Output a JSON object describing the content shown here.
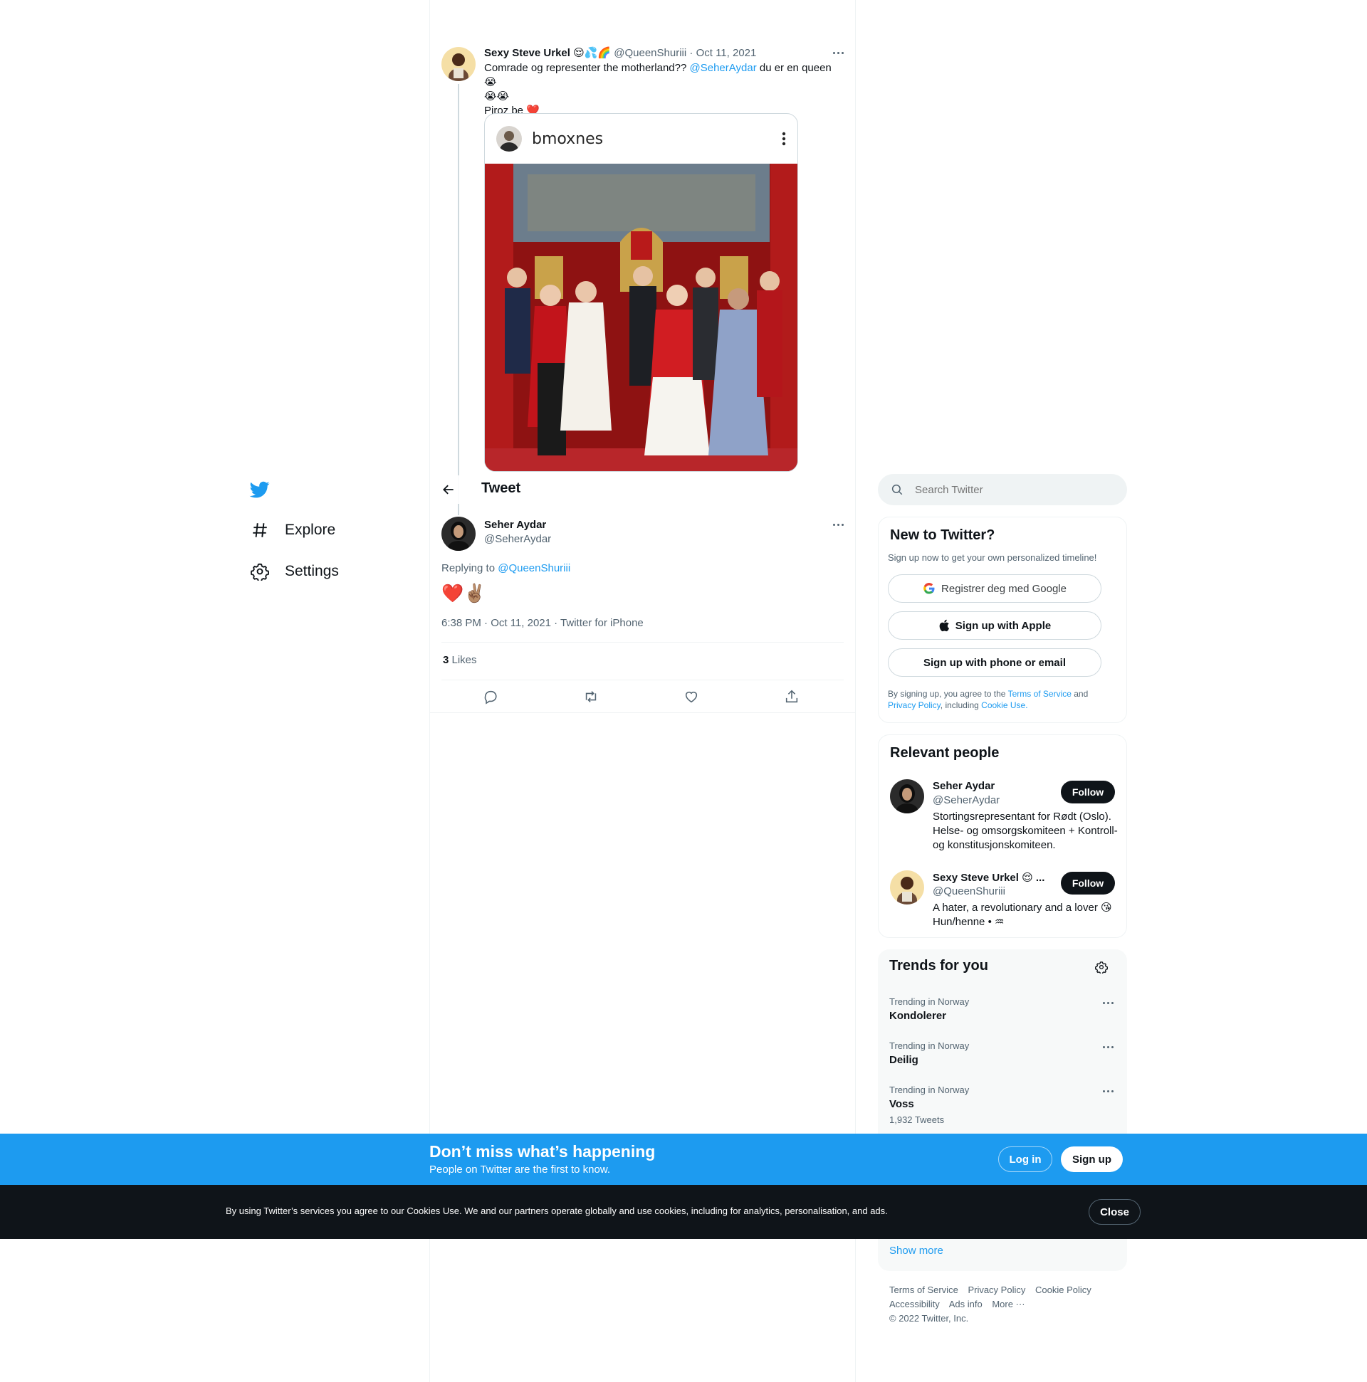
{
  "nav": {
    "logo": "twitter-bird-icon",
    "items": [
      {
        "label": "Explore",
        "icon": "hashtag-icon"
      },
      {
        "label": "Settings",
        "icon": "gear-icon"
      }
    ]
  },
  "parent_tweet": {
    "display_name": "Sexy Steve Urkel",
    "name_emoji": "😌💦🌈",
    "handle": "@QueenShuriii",
    "separator": "·",
    "date": "Oct 11, 2021",
    "text_before": "Comrade og representer the motherland?? ",
    "mention": "@SeherAydar",
    "text_after": " du er en queen 😭",
    "line2": "😭😭",
    "line3": "Piroz be ❤️",
    "card": {
      "username": "bmoxnes",
      "menu_icon": "vertical-dots-icon"
    }
  },
  "header": {
    "back_icon": "arrow-left-icon",
    "title": "Tweet"
  },
  "main_tweet": {
    "display_name": "Seher Aydar",
    "handle": "@SeherAydar",
    "replying_prefix": "Replying to ",
    "replying_to": "@QueenShuriii",
    "text": "❤️✌🏽",
    "meta": "6:38 PM · Oct 11, 2021 · Twitter for iPhone",
    "likes_count": "3",
    "likes_label": " Likes",
    "actions": [
      "reply-icon",
      "retweet-icon",
      "like-icon",
      "share-icon"
    ]
  },
  "sidebar": {
    "search_placeholder": "Search Twitter",
    "new_to_twitter": {
      "title": "New to Twitter?",
      "subtitle": "Sign up now to get your own personalized timeline!",
      "google_label": "Registrer deg med Google",
      "apple_label": "Sign up with Apple",
      "phone_label": "Sign up with phone or email",
      "legal_1": "By signing up, you agree to the ",
      "terms": "Terms of Service",
      "legal_2": " and",
      "privacy": "Privacy Policy",
      "legal_3": ", including ",
      "cookie": "Cookie Use."
    },
    "relevant_people": {
      "title": "Relevant people",
      "people": [
        {
          "name": "Seher Aydar",
          "handle": "@SeherAydar",
          "bio": "Stortingsrepresentant for Rødt (Oslo). Helse- og omsorgskomiteen + Kontroll- og konstitusjonskomiteen.",
          "follow": "Follow"
        },
        {
          "name": "Sexy Steve Urkel 😌 ...",
          "handle": "@QueenShuriii",
          "bio": "A hater, a revolutionary and a lover 😘 Hun/henne • ♒",
          "follow": "Follow"
        }
      ]
    },
    "trends": {
      "title": "Trends for you",
      "settings_icon": "gear-icon",
      "items": [
        {
          "category": "Trending in Norway",
          "name": "Kondolerer",
          "count": ""
        },
        {
          "category": "Trending in Norway",
          "name": "Deilig",
          "count": ""
        },
        {
          "category": "Trending in Norway",
          "name": "Voss",
          "count": "1,932 Tweets"
        }
      ],
      "show_more": "Show more"
    },
    "footer": {
      "links_row1": [
        "Terms of Service",
        "Privacy Policy",
        "Cookie Policy"
      ],
      "links_row2": [
        "Accessibility",
        "Ads info",
        "More ···"
      ],
      "copyright": "© 2022 Twitter, Inc."
    }
  },
  "banner": {
    "title": "Don’t miss what’s happening",
    "subtitle": "People on Twitter are the first to know.",
    "login": "Log in",
    "signup": "Sign up"
  },
  "cookie_bar": {
    "text": "By using Twitter’s services you agree to our Cookies Use. We and our partners operate globally and use cookies, including for analytics, personalisation, and ads.",
    "close": "Close"
  },
  "colors": {
    "accent": "#1d9bf0",
    "text": "#0f1419",
    "muted": "#536471",
    "dark_bar": "#0f1419"
  }
}
